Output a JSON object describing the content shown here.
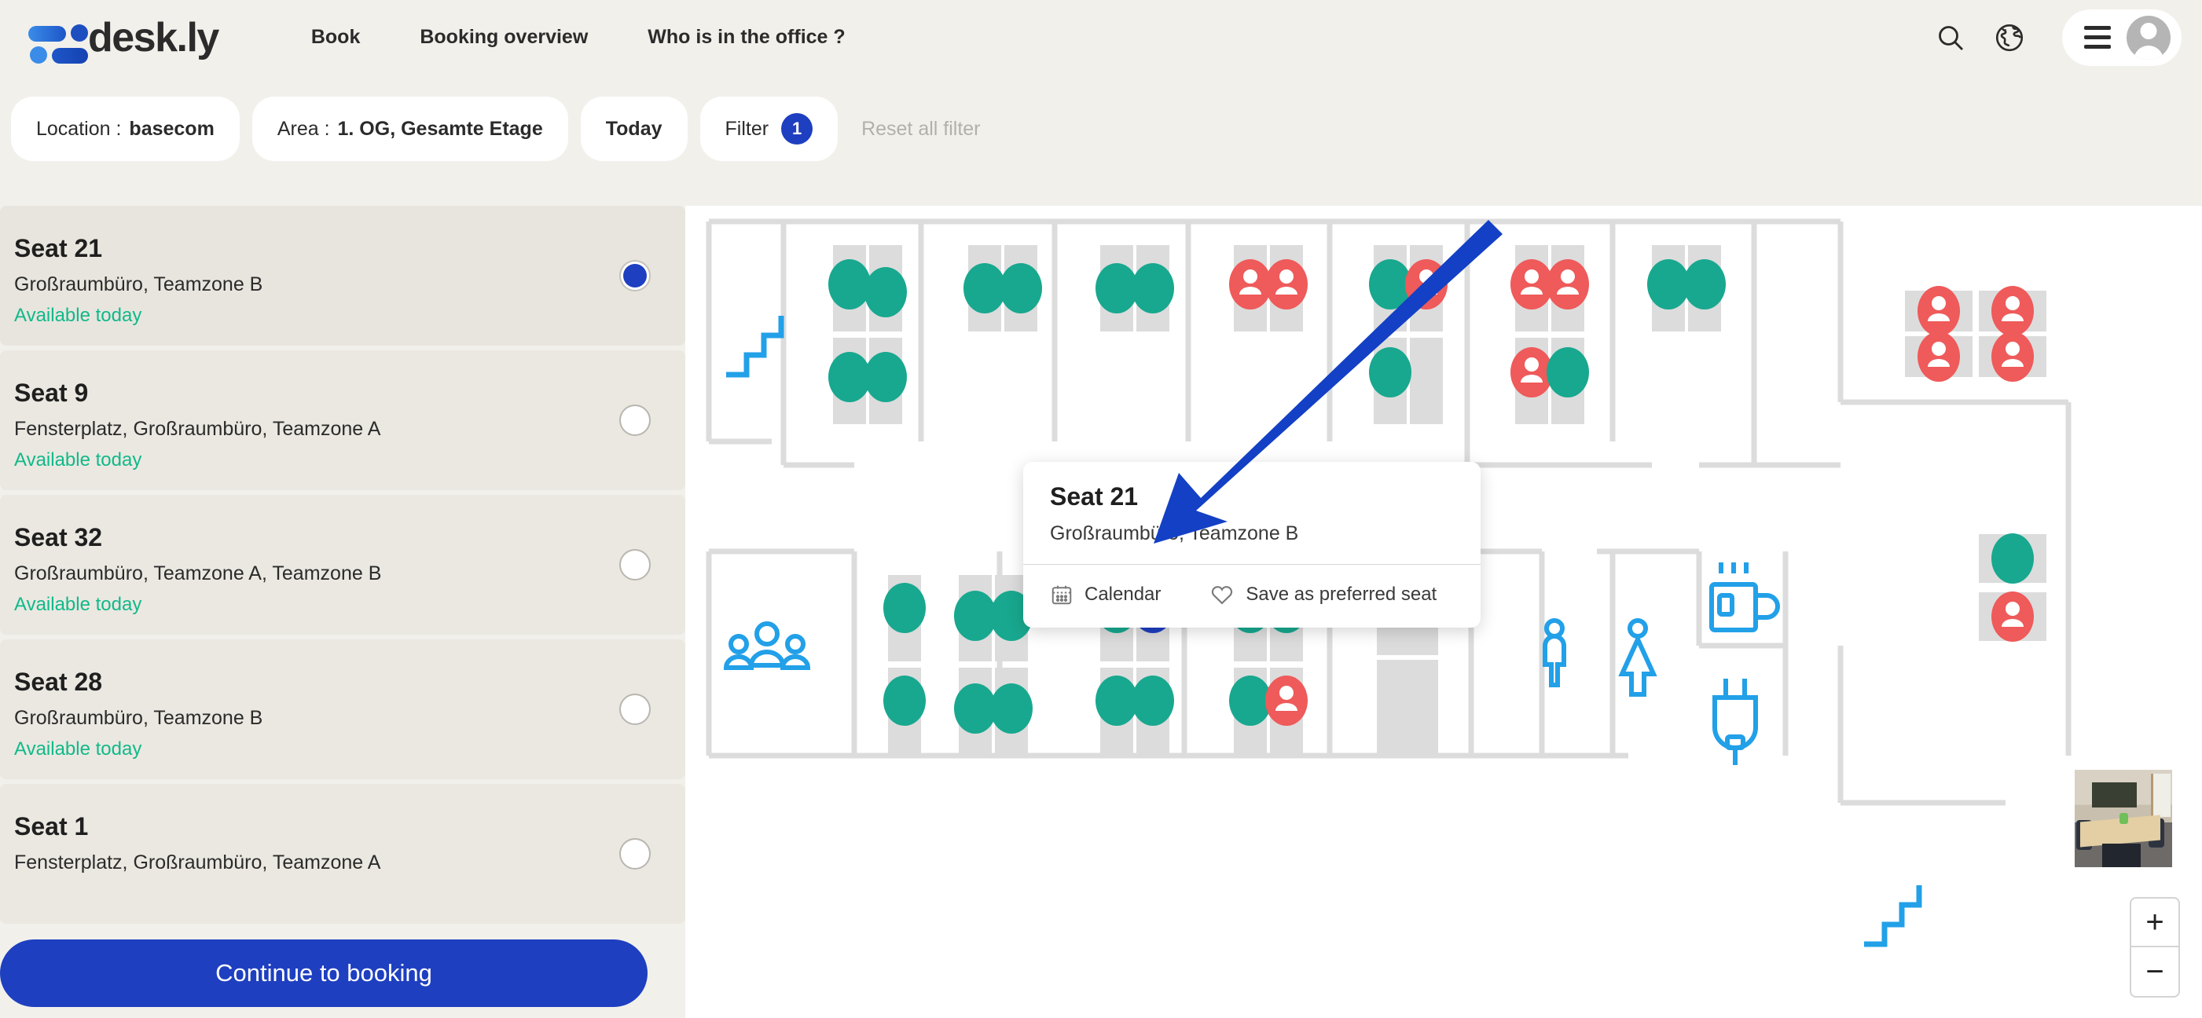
{
  "header": {
    "logo_text": "desk.ly",
    "nav": [
      {
        "label": "Book"
      },
      {
        "label": "Booking overview"
      },
      {
        "label": "Who is in the office ?"
      }
    ],
    "icons": {
      "search": "search-icon",
      "language": "globe-icon",
      "menu": "hamburger-menu-icon",
      "avatar": "user-avatar-icon"
    }
  },
  "filterbar": {
    "location_label": "Location :",
    "location_value": "basecom",
    "area_label": "Area :",
    "area_value": "1. OG, Gesamte Etage",
    "today_label": "Today",
    "filter_label": "Filter",
    "filter_count": "1",
    "reset_label": "Reset all filter"
  },
  "sidebar": {
    "seats": [
      {
        "name": "Seat 21",
        "attributes": "Großraumbüro, Teamzone B",
        "status": "Available today",
        "selected": true
      },
      {
        "name": "Seat 9",
        "attributes": "Fensterplatz, Großraumbüro, Teamzone A",
        "status": "Available today",
        "selected": false
      },
      {
        "name": "Seat 32",
        "attributes": "Großraumbüro, Teamzone A, Teamzone B",
        "status": "Available today",
        "selected": false
      },
      {
        "name": "Seat 28",
        "attributes": "Großraumbüro, Teamzone B",
        "status": "Available today",
        "selected": false
      },
      {
        "name": "Seat 1",
        "attributes": "Fensterplatz, Großraumbüro, Teamzone A",
        "status": "",
        "selected": false
      }
    ],
    "cta_label": "Continue to booking"
  },
  "tooltip": {
    "title": "Seat 21",
    "subtitle": "Großraumbüro, Teamzone B",
    "calendar_label": "Calendar",
    "preferred_label": "Save as preferred seat"
  },
  "map": {
    "zoom_in": "+",
    "zoom_out": "−",
    "amenities": [
      {
        "icon": "stairs-icon"
      },
      {
        "icon": "meeting-group-icon"
      },
      {
        "icon": "restroom-male-icon"
      },
      {
        "icon": "restroom-female-icon"
      },
      {
        "icon": "coffee-icon"
      },
      {
        "icon": "power-plug-icon"
      },
      {
        "icon": "stairs-icon"
      }
    ],
    "legend": {
      "available_color": "#18a88f",
      "occupied_color": "#ef5a5a",
      "selected_color": "#1e3fc0",
      "desk_color": "#dcdcdc",
      "wall_color": "#dcdcdc"
    }
  }
}
